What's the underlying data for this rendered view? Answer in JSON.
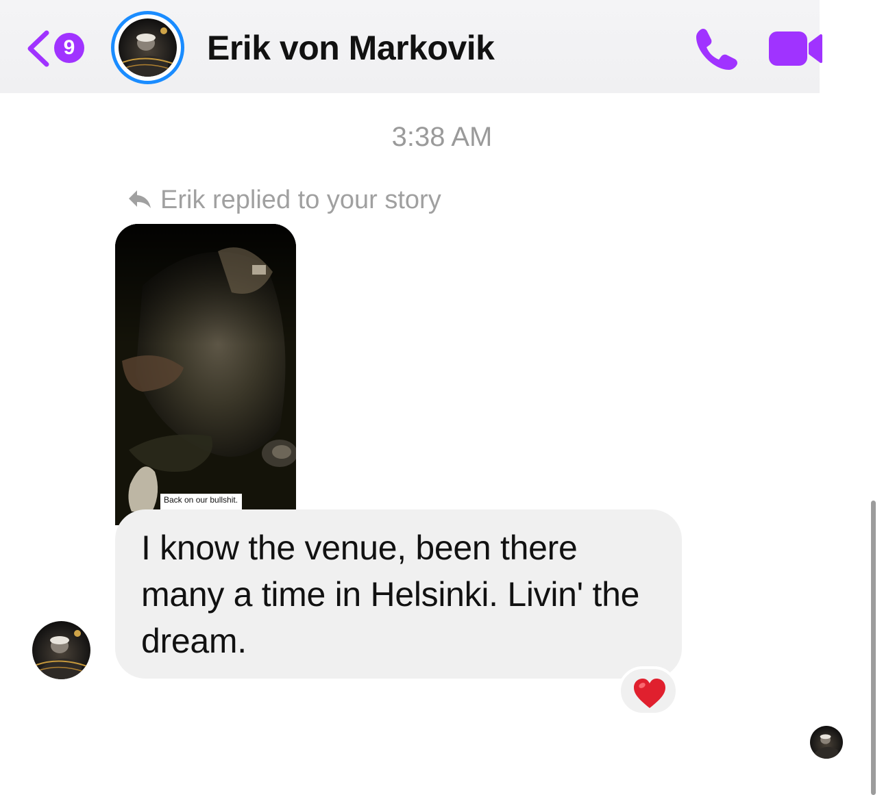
{
  "header": {
    "back_badge_count": "9",
    "contact_name": "Erik von Markovik",
    "accent_color": "#a033ff",
    "avatar_ring_color": "#1a8cff"
  },
  "conversation": {
    "timestamp": "3:38 AM",
    "reply_note": "Erik replied to your story",
    "story_caption": "Back on our bullshit.",
    "message_text": "I know the venue, been there many a time in Helsinki. Livin' the dream.",
    "reaction": "❤️"
  },
  "icons": {
    "back": "chevron-left-icon",
    "call": "phone-icon",
    "video": "video-camera-icon",
    "reply": "reply-arrow-icon",
    "reaction": "heart-icon"
  }
}
